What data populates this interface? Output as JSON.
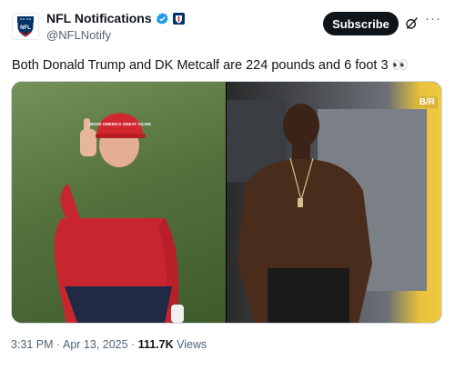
{
  "account": {
    "display_name": "NFL Notifications",
    "handle": "@NFLNotify"
  },
  "actions": {
    "subscribe_label": "Subscribe",
    "more_label": "···"
  },
  "tweet": {
    "text": "Both Donald Trump and DK Metcalf are 224 pounds and 6 foot 3 👀",
    "media": {
      "left_hat_text": "MAKE AMERICA GREAT AGAIN",
      "right_watermark": "B/R"
    },
    "time": "3:31 PM",
    "separator_1": " · ",
    "date": "Apr 13, 2025",
    "separator_2": " · ",
    "views_count": "111.7K",
    "views_label": " Views"
  },
  "colors": {
    "accent": "#1d9bf0",
    "subscribe_bg": "#0f1419",
    "muted_text": "#536471"
  }
}
